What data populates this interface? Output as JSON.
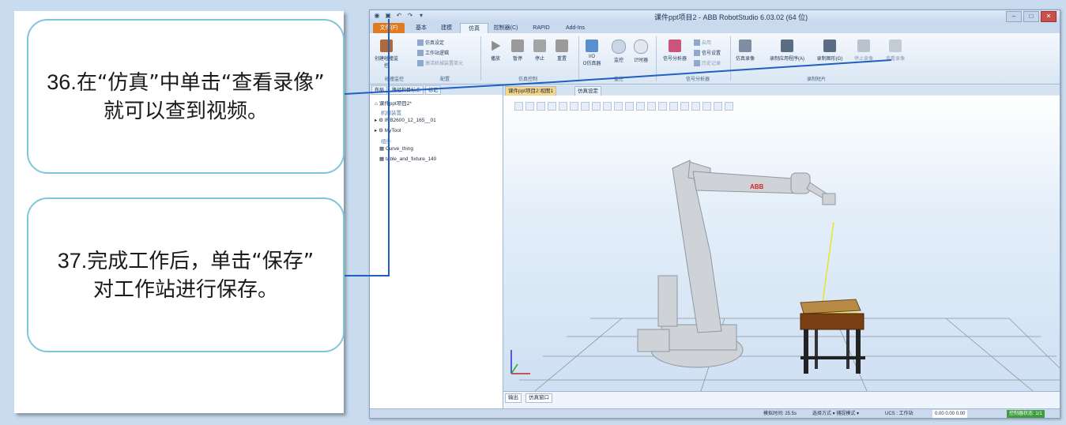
{
  "callouts": [
    {
      "num": "36.",
      "line1": "在“仿真”中单击“查看录像”",
      "line2": "就可以查到视频。"
    },
    {
      "num": "37.",
      "line1": "完成工作后，单击“保存”",
      "line2": "对工作站进行保存。"
    }
  ],
  "window": {
    "title": "课件ppt项目2 - ABB RobotStudio 6.03.02 (64 位)",
    "tabs": [
      "文件(F)",
      "基本",
      "建模",
      "仿真",
      "控制器(C)",
      "RAPID",
      "Add-Ins"
    ],
    "active_tab": "仿真"
  },
  "ribbon": {
    "collision": "创建碰撞监控",
    "sim_setup": "仿真设定",
    "station_logic": "工作站逻辑",
    "activate_units": "激活机械装置单元",
    "play": "播放",
    "pause": "暂停",
    "stop": "停止",
    "reset": "重置",
    "io_sim_a": "I/O",
    "io_sim_b": "O仿真器",
    "monitor": "监控",
    "timer": "计时器",
    "signal_analyzer": "信号分析器",
    "enable": "启用",
    "signal_settings": "信号设置",
    "history": "历史记录",
    "sim_record": "仿真录像",
    "record_app": "录制应用程序(A)",
    "record_graphics": "录制图形(G)",
    "stop_record": "停止录像",
    "view_record": "查看录像",
    "groups": {
      "collision": "碰撞监控",
      "config": "配置",
      "sim_control": "仿真控制",
      "monitor": "监控",
      "signal_analyzer": "信号分析器",
      "record": "录制短片"
    }
  },
  "tree": {
    "tabs": [
      "布局",
      "路径和目标点",
      "标记"
    ],
    "station": "课件ppt项目2*",
    "mechanisms": "机械装置",
    "robot": "IRB2600_12_165__01",
    "tool": "MyTool",
    "parts_label": "组件",
    "part1": "Curve_thing",
    "part2": "table_and_fixture_140"
  },
  "viewport": {
    "tabs": [
      "课件ppt项目2:视图1",
      "仿真设定"
    ],
    "robot_logo": "ABB"
  },
  "output_tabs": [
    "输出",
    "仿真窗口"
  ],
  "status": {
    "sim_time": "模拟时间: 25.5s",
    "selection": "选择方式 ▾ 捕捉模式 ▾",
    "ucs": "UCS : 工作站",
    "coords": "0.00  0.00  0.00",
    "controller": "控制器状态: 1/1"
  },
  "colors": {
    "accent": "#e07a1f",
    "leader_line": "#1f5fbf",
    "callout_border": "#7fc6dc"
  }
}
